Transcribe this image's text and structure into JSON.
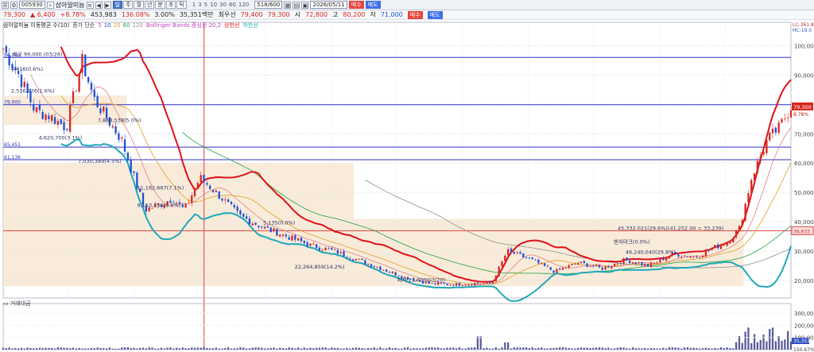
{
  "toolbar": {
    "code": "005930",
    "name": "삼아알미늄",
    "tabs": [
      "일",
      "주",
      "월",
      "년",
      "분",
      "초",
      "틱"
    ],
    "active_tab": "일",
    "periods": [
      "1",
      "3",
      "5",
      "10",
      "30",
      "60",
      "120"
    ],
    "count": "518/600",
    "date": "2026/05/11",
    "buy_label": "매수",
    "sell_label": "매도"
  },
  "info": {
    "price": "79,300",
    "change": "▲ 6,400",
    "change_pct": "+8.78%",
    "volume": "453,983",
    "vol_pct": "136.08%",
    "turnover": "3.00%",
    "amount": "35,351백만",
    "prior_label": "최우선",
    "bid": "79,400",
    "ask": "79,300",
    "open_label": "시",
    "open": "72,800",
    "high_label": "고",
    "high": "80,200",
    "low_label": "저",
    "low": "71,000"
  },
  "legend": {
    "title": "삼아알미늄 이동평균 수(10)",
    "ma_label": "종가 단순",
    "ma_periods": [
      "5",
      "10",
      "20",
      "60",
      "120"
    ],
    "ma_colors": [
      "#e040e0",
      "#2050e0",
      "#e0a020",
      "#20a040",
      "#909090"
    ],
    "bb_label": "Bollinger Bands 중심선 20,2",
    "bb_upper": "상한선",
    "bb_lower": "하한선",
    "volume_title": "거래대금"
  },
  "colors": {
    "up": "#d6281e",
    "down": "#1e4fd6",
    "bb_upper": "#e0101a",
    "bb_lower": "#20a8b8",
    "hline": "#3030c8",
    "hline_red": "#e04040",
    "box": "#f7e7d3",
    "price_box": "#d6281e"
  },
  "chart_data": {
    "type": "candlestick",
    "y_axis": {
      "ylim": [
        14000,
        108000
      ],
      "ticks": [
        20000,
        30000,
        40000,
        50000,
        60000,
        70000,
        80000,
        90000,
        100000
      ],
      "tick_labels": [
        "20,000",
        "30,000",
        "40,000",
        "50,000",
        "60,000",
        "70,000",
        "80,000",
        "90,000",
        "100,000"
      ],
      "top_labels": [
        "LC-361.8%",
        "HC-19.0"
      ]
    },
    "volume_axis": {
      "ylim": [
        0,
        380000
      ],
      "ticks": [
        100000,
        200000,
        300000
      ],
      "tick_labels": [
        "100,000",
        "200,000",
        "300,000"
      ],
      "badge": "35,351",
      "bottom_label": "150.67%"
    },
    "current_price": {
      "value": 79300,
      "label": "79,300",
      "sub": "8.78%"
    },
    "red_line_price": {
      "value": 36933,
      "label": "36,933"
    },
    "hlines": [
      {
        "value": 96000,
        "label": "96,000"
      },
      {
        "value": 79900,
        "label": "79,900"
      },
      {
        "value": 65451,
        "label": "65,451"
      },
      {
        "value": 61136,
        "label": "61,136"
      }
    ],
    "box_top": {
      "from": 0.0,
      "to": 0.157,
      "value_hi": 83000,
      "value_lo": 73000
    },
    "box_bottom": {
      "from": 0.0,
      "to": 0.445,
      "value_hi": 60000,
      "value_lo": 18000
    },
    "box_right": {
      "from": 0.445,
      "to": 0.94,
      "value_hi": 41000,
      "value_lo": 18000
    },
    "annotations": [
      {
        "text": "최고 99,000 (03/26)",
        "x": 0.012,
        "y": 96500
      },
      {
        "text": "4,416(0.6%)",
        "x": 0.01,
        "y": 91500
      },
      {
        "text": "2,516,776(1.6%)",
        "x": 0.01,
        "y": 84000
      },
      {
        "text": "4,620,700(3.1%)",
        "x": 0.045,
        "y": 68000
      },
      {
        "text": "7,868,538(5.0%)",
        "x": 0.12,
        "y": 74000
      },
      {
        "text": "7,030,389(4.5%)",
        "x": 0.095,
        "y": 60000
      },
      {
        "text": "11,162,667(7.1%)",
        "x": 0.17,
        "y": 51000
      },
      {
        "text": "9,153,256(6.8%)",
        "x": 0.17,
        "y": 45000
      },
      {
        "text": "5,135(0.0%)",
        "x": 0.33,
        "y": 39000
      },
      {
        "text": "22,264,859(14.2%)",
        "x": 0.37,
        "y": 24000
      },
      {
        "text": "최저 17,600(03/20)",
        "x": 0.5,
        "y": 19500
      },
      {
        "text": "45,332,021(29.6%)(41,252.00 = 33,239)",
        "x": 0.78,
        "y": 37200
      },
      {
        "text": "벤치마크(0.0%)",
        "x": 0.775,
        "y": 32500
      },
      {
        "text": "46,240,040(29.8%)",
        "x": 0.79,
        "y": 29000
      }
    ],
    "candles_count": 518,
    "anchor_points": [
      [
        0,
        99000
      ],
      [
        0.02,
        90000
      ],
      [
        0.04,
        78000
      ],
      [
        0.06,
        76000
      ],
      [
        0.08,
        72000
      ],
      [
        0.1,
        95000
      ],
      [
        0.115,
        82000
      ],
      [
        0.13,
        76000
      ],
      [
        0.15,
        68000
      ],
      [
        0.165,
        56000
      ],
      [
        0.18,
        44000
      ],
      [
        0.2,
        46000
      ],
      [
        0.215,
        48000
      ],
      [
        0.23,
        44000
      ],
      [
        0.25,
        55000
      ],
      [
        0.27,
        50000
      ],
      [
        0.3,
        42000
      ],
      [
        0.33,
        38000
      ],
      [
        0.36,
        35000
      ],
      [
        0.39,
        32000
      ],
      [
        0.42,
        30000
      ],
      [
        0.45,
        27000
      ],
      [
        0.48,
        24000
      ],
      [
        0.51,
        21000
      ],
      [
        0.54,
        19000
      ],
      [
        0.57,
        18500
      ],
      [
        0.6,
        19000
      ],
      [
        0.62,
        19000
      ],
      [
        0.64,
        30000
      ],
      [
        0.67,
        27000
      ],
      [
        0.7,
        23000
      ],
      [
        0.73,
        26000
      ],
      [
        0.76,
        24000
      ],
      [
        0.79,
        27000
      ],
      [
        0.82,
        25000
      ],
      [
        0.85,
        29000
      ],
      [
        0.88,
        28000
      ],
      [
        0.9,
        31000
      ],
      [
        0.92,
        33000
      ],
      [
        0.935,
        38000
      ],
      [
        0.95,
        55000
      ],
      [
        0.97,
        68000
      ],
      [
        0.985,
        72000
      ],
      [
        1.0,
        79300
      ]
    ]
  }
}
